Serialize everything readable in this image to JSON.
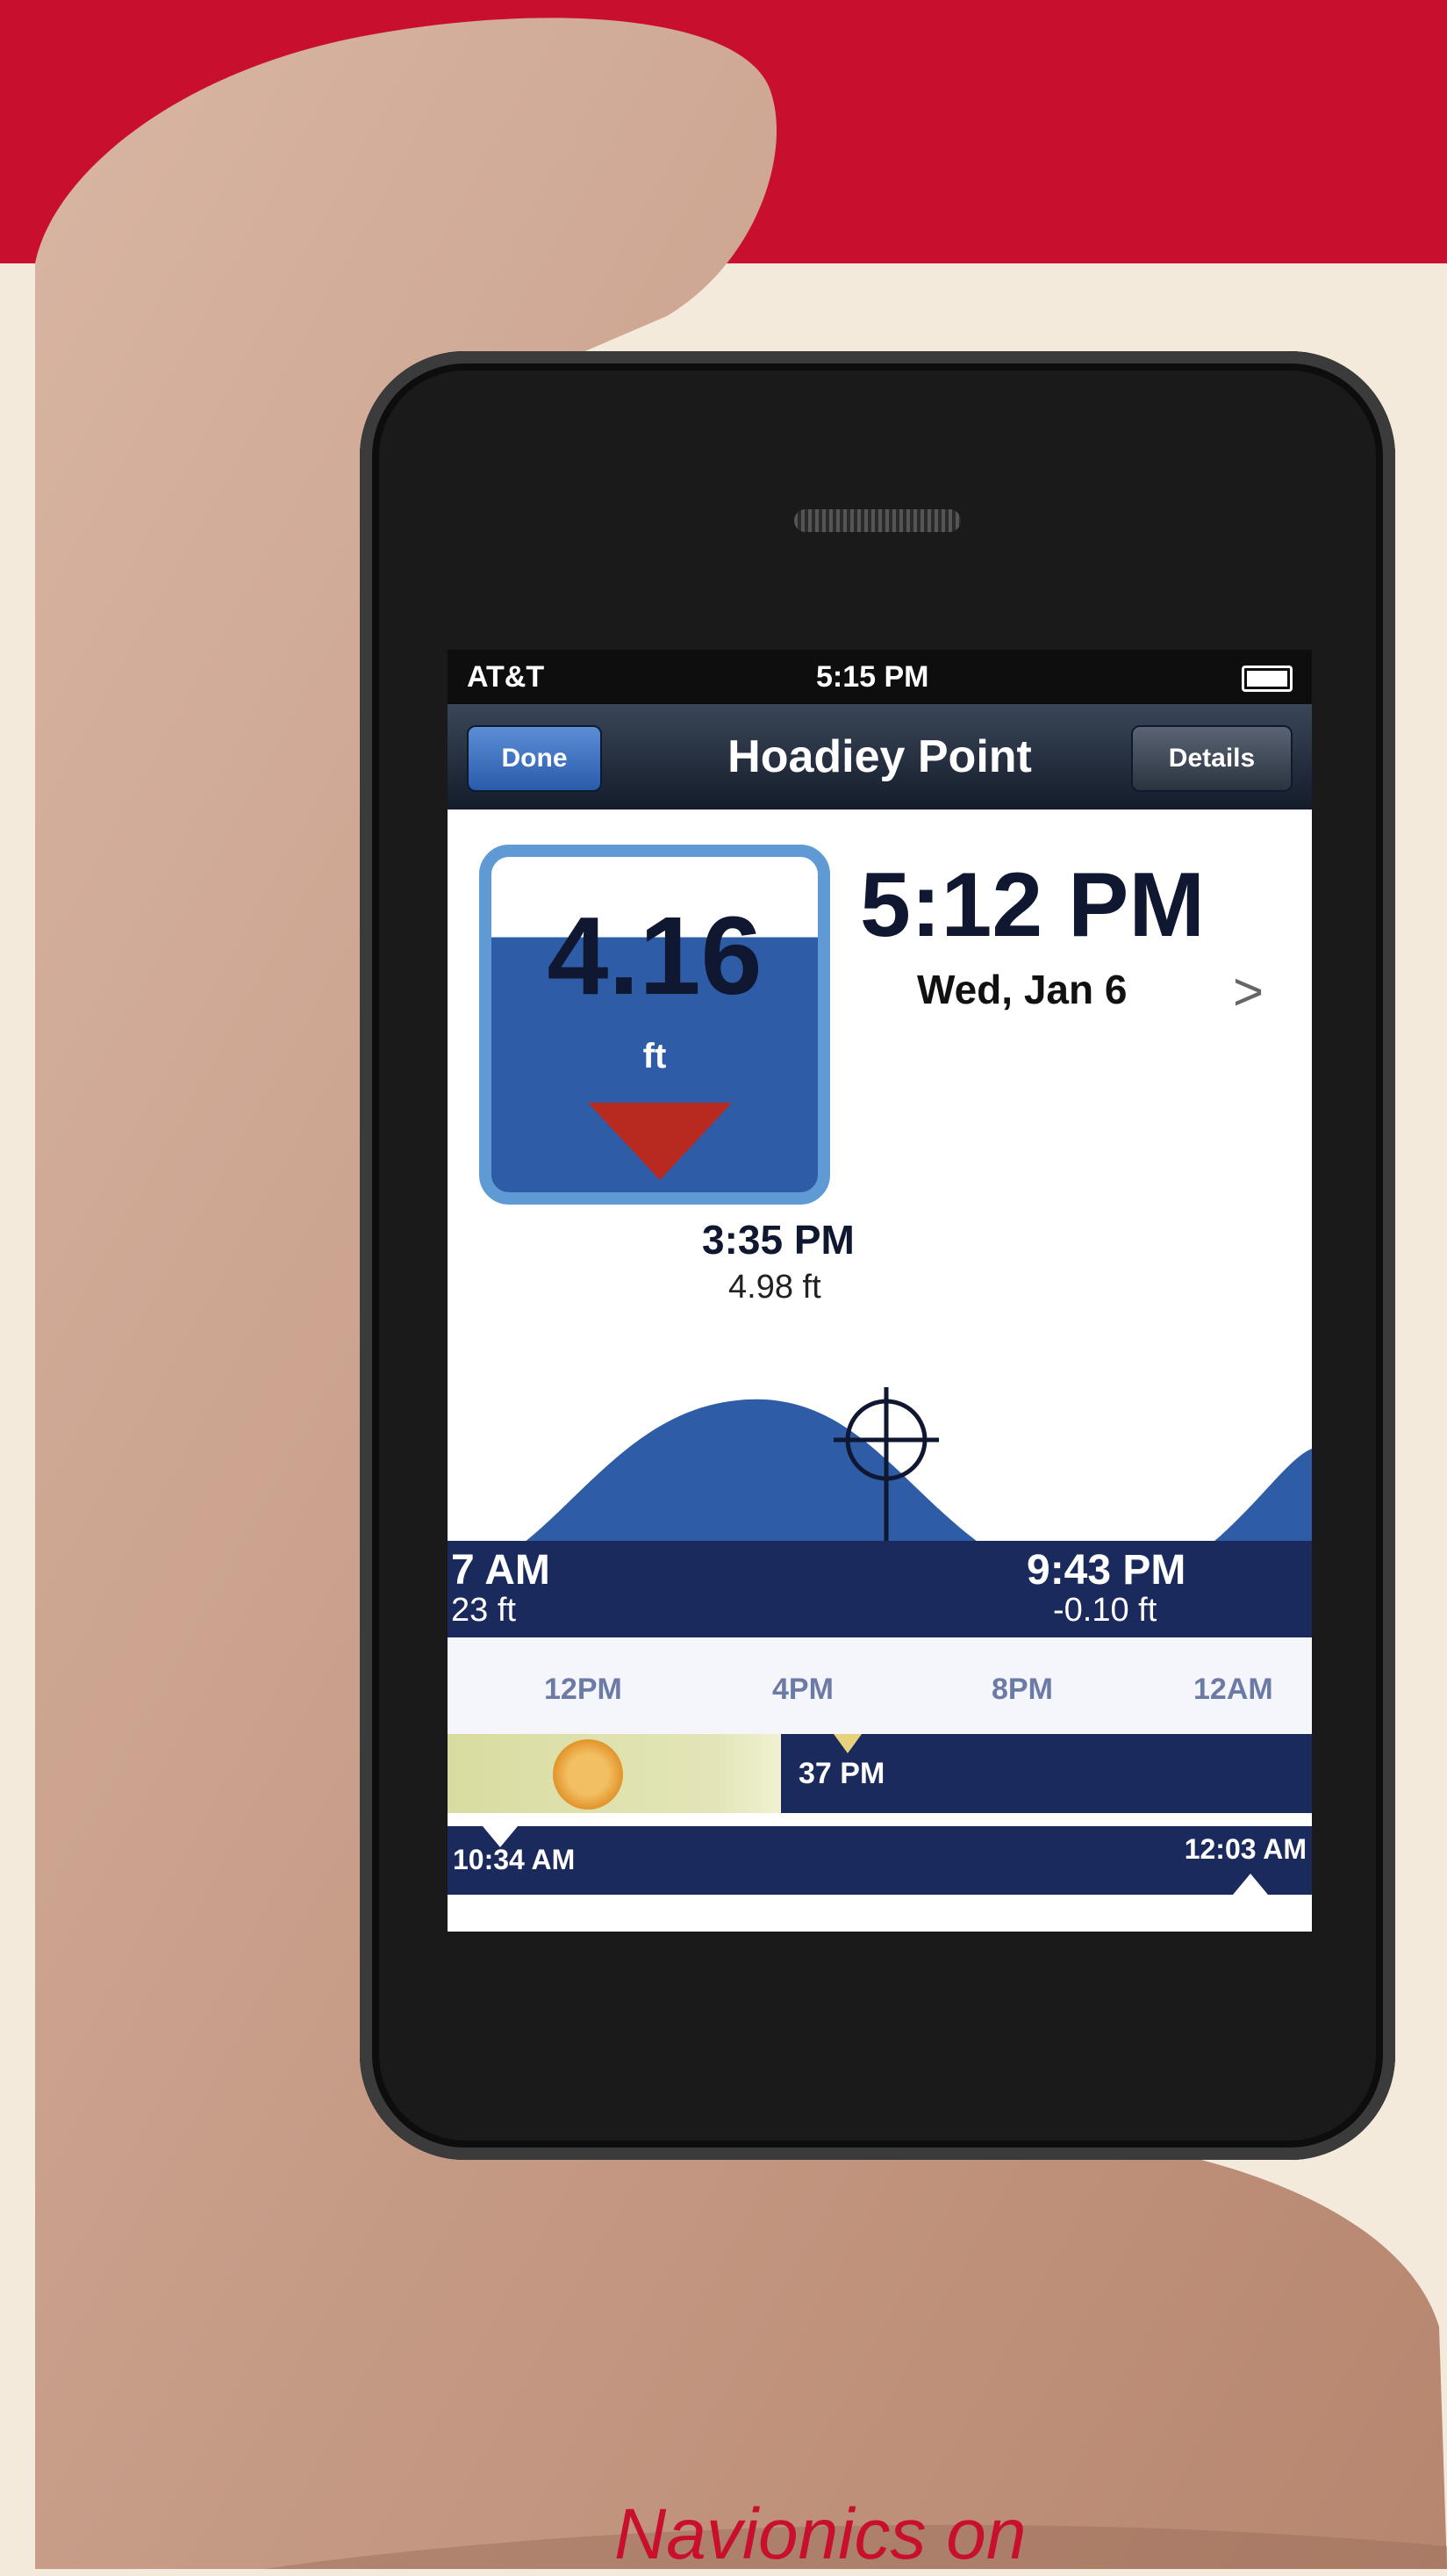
{
  "colors": {
    "banner": "#c8102e",
    "background": "#f3eadc",
    "tide_fill": "#2e5ca6",
    "bar": "#1b2a5c",
    "caption": "#c8102e"
  },
  "status_bar": {
    "carrier": "AT&T",
    "time": "5:15 PM"
  },
  "nav": {
    "done_label": "Done",
    "title": "Hoadiey Point",
    "details_label": "Details"
  },
  "tile": {
    "value": "4.16",
    "unit": "ft",
    "direction": "falling"
  },
  "current": {
    "time": "5:12 PM",
    "date": "Wed, Jan 6",
    "next_icon": "chevron-right-icon"
  },
  "high_tide": {
    "time": "3:35 PM",
    "height": "4.98 ft"
  },
  "low_left": {
    "time": "7 AM",
    "height": "23 ft"
  },
  "low_right": {
    "time": "9:43 PM",
    "height": "-0.10 ft"
  },
  "axis_ticks": [
    "12PM",
    "4PM",
    "8PM",
    "12AM"
  ],
  "sun": {
    "label": "37 PM",
    "icon": "sun-icon"
  },
  "moon": {
    "left": "10:34 AM",
    "right": "12:03 AM"
  },
  "caption": "Navionics on"
}
